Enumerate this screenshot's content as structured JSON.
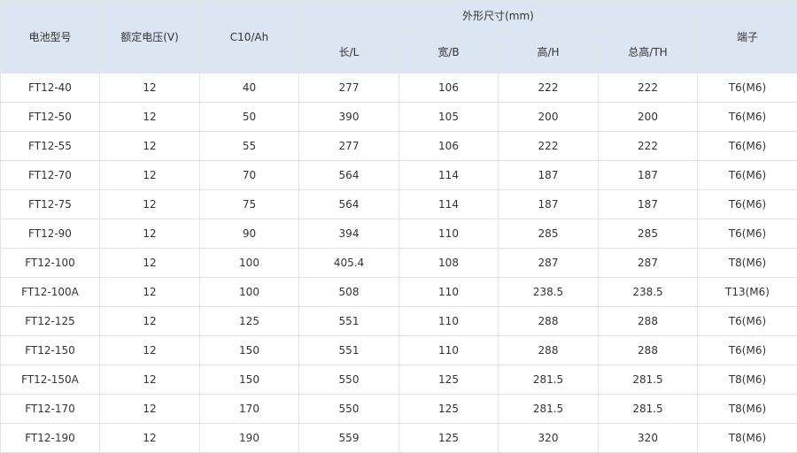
{
  "table": {
    "headers": {
      "model": "电池型号",
      "voltage": "额定电压(V)",
      "capacity": "C10/Ah",
      "dimensions": "外形尺寸(mm)",
      "length": "长/L",
      "width": "宽/B",
      "height": "高/H",
      "total_height": "总高/TH",
      "terminal": "端子"
    },
    "rows": [
      [
        "FT12-40",
        "12",
        "40",
        "277",
        "106",
        "222",
        "222",
        "T6(M6)"
      ],
      [
        "FT12-50",
        "12",
        "50",
        "390",
        "105",
        "200",
        "200",
        "T6(M6)"
      ],
      [
        "FT12-55",
        "12",
        "55",
        "277",
        "106",
        "222",
        "222",
        "T6(M6)"
      ],
      [
        "FT12-70",
        "12",
        "70",
        "564",
        "114",
        "187",
        "187",
        "T6(M6)"
      ],
      [
        "FT12-75",
        "12",
        "75",
        "564",
        "114",
        "187",
        "187",
        "T6(M6)"
      ],
      [
        "FT12-90",
        "12",
        "90",
        "394",
        "110",
        "285",
        "285",
        "T6(M6)"
      ],
      [
        "FT12-100",
        "12",
        "100",
        "405.4",
        "108",
        "287",
        "287",
        "T8(M6)"
      ],
      [
        "FT12-100A",
        "12",
        "100",
        "508",
        "110",
        "238.5",
        "238.5",
        "T13(M6)"
      ],
      [
        "FT12-125",
        "12",
        "125",
        "551",
        "110",
        "288",
        "288",
        "T6(M6)"
      ],
      [
        "FT12-150",
        "12",
        "150",
        "551",
        "110",
        "288",
        "288",
        "T6(M6)"
      ],
      [
        "FT12-150A",
        "12",
        "150",
        "550",
        "125",
        "281.5",
        "281.5",
        "T8(M6)"
      ],
      [
        "FT12-170",
        "12",
        "170",
        "550",
        "125",
        "281.5",
        "281.5",
        "T8(M6)"
      ],
      [
        "FT12-190",
        "12",
        "190",
        "559",
        "125",
        "320",
        "320",
        "T8(M6)"
      ]
    ]
  }
}
